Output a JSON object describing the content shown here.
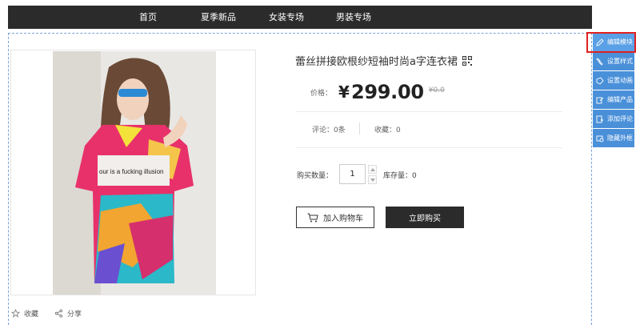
{
  "nav": {
    "items": [
      "首页",
      "夏季新品",
      "女装专场",
      "男装专场"
    ]
  },
  "product": {
    "title": "蕾丝拼接欧根纱短袖时尚a字连衣裙",
    "price_label": "价格：",
    "currency": "¥",
    "price": "299.00",
    "old_price": "¥0.0",
    "reviews": "评论：0条",
    "favorites_count": "收藏：0",
    "qty_label": "购买数量：",
    "qty_value": "1",
    "stock": "库存量：0",
    "add_to_cart": "加入购物车",
    "buy_now": "立即购买",
    "image_text": "our is a fucking illusion"
  },
  "actions": {
    "favorite": "收藏",
    "share": "分享"
  },
  "side_panel": {
    "items": [
      "编辑模块",
      "设置样式",
      "设置动画",
      "编辑产品",
      "添加评论",
      "隐藏外框"
    ]
  },
  "colors": {
    "nav_bg": "#2b2b2b",
    "panel_blue": "#4a90d9",
    "highlight": "#e02020"
  }
}
